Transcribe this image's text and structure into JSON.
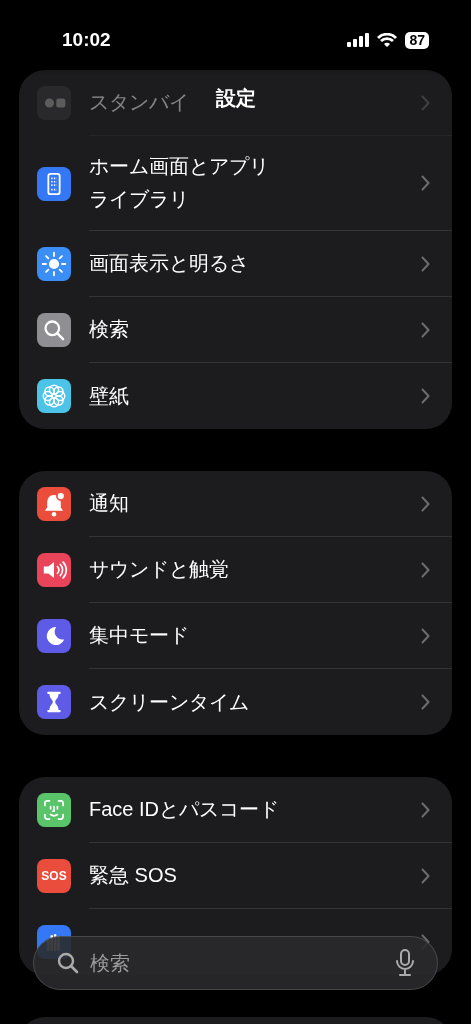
{
  "status_bar": {
    "time": "10:02",
    "battery": "87"
  },
  "nav": {
    "title": "設定"
  },
  "groups": [
    {
      "rows": [
        {
          "kind": "standby",
          "label": "スタンバイ",
          "faded": true
        },
        {
          "kind": "home",
          "label": "ホーム画面とアプリライブラリ",
          "faded": false
        },
        {
          "kind": "display",
          "label": "画面表示と明るさ",
          "faded": false
        },
        {
          "kind": "search",
          "label": "検索",
          "faded": false
        },
        {
          "kind": "wallpaper",
          "label": "壁紙",
          "faded": false
        }
      ]
    },
    {
      "rows": [
        {
          "kind": "notifications",
          "label": "通知",
          "faded": false
        },
        {
          "kind": "sound",
          "label": "サウンドと触覚",
          "faded": false
        },
        {
          "kind": "focus",
          "label": "集中モード",
          "faded": false
        },
        {
          "kind": "screentime",
          "label": "スクリーンタイム",
          "faded": false
        }
      ]
    },
    {
      "rows": [
        {
          "kind": "faceid",
          "label": "Face IDとパスコード",
          "faded": false
        },
        {
          "kind": "sos",
          "label": "緊急 SOS",
          "icon_text": "SOS",
          "faded": false
        },
        {
          "kind": "privacy",
          "faded": false
        }
      ]
    }
  ],
  "search_bar": {
    "placeholder": "検索"
  }
}
